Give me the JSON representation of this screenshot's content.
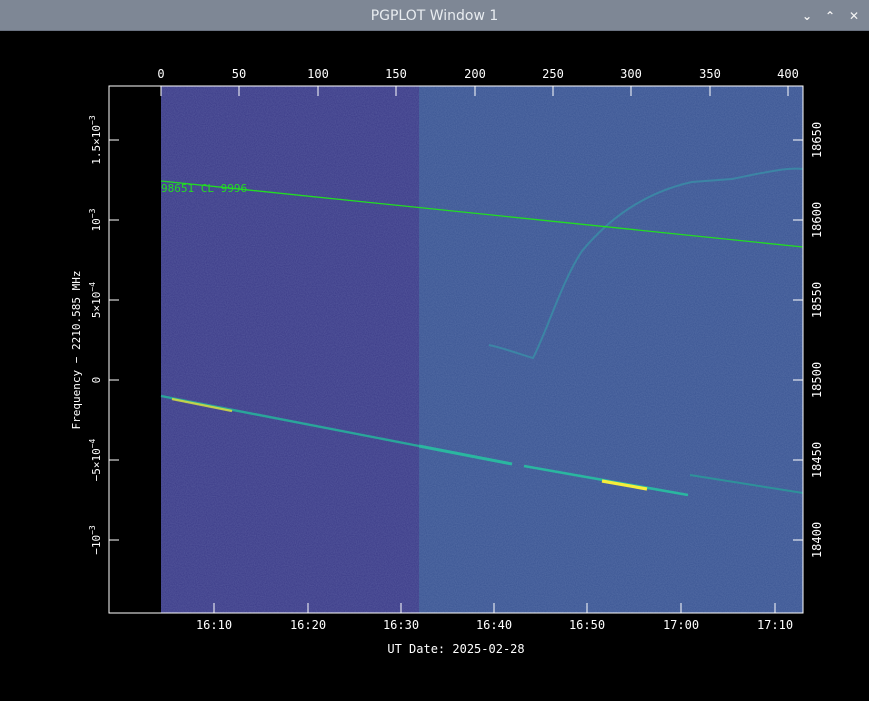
{
  "window": {
    "title": "PGPLOT Window 1",
    "buttons": {
      "minimize": "⌄",
      "maximize": "⌃",
      "close": "✕"
    }
  },
  "plot": {
    "xlabel": "UT Date: 2025-02-28",
    "ylabel": "Frequency − 2210.585 MHz",
    "top_ticks": [
      "0",
      "50",
      "100",
      "150",
      "200",
      "250",
      "300",
      "350",
      "400"
    ],
    "bottom_ticks": [
      "16:10",
      "16:20",
      "16:30",
      "16:40",
      "16:50",
      "17:00",
      "17:10"
    ],
    "left_ticks": [
      {
        "mant": "1.5×10",
        "exp": "−3"
      },
      {
        "mant": "10",
        "exp": "−3"
      },
      {
        "mant": "5×10",
        "exp": "−4"
      },
      {
        "mant": "0",
        "exp": ""
      },
      {
        "mant": "−5×10",
        "exp": "−4"
      },
      {
        "mant": "−10",
        "exp": "−3"
      }
    ],
    "right_ticks": [
      "18650",
      "18600",
      "18550",
      "18500",
      "18450",
      "18400"
    ],
    "annotation": "98651 CL 9996",
    "colors": {
      "background": "#000000",
      "left_panel": "#3b3b88",
      "right_panel": "#3a5593",
      "prediction_line": "#22dd22",
      "signal": "#2ab79a",
      "signal_peak": "#f6ee3a",
      "axes": "#ffffff"
    }
  }
}
